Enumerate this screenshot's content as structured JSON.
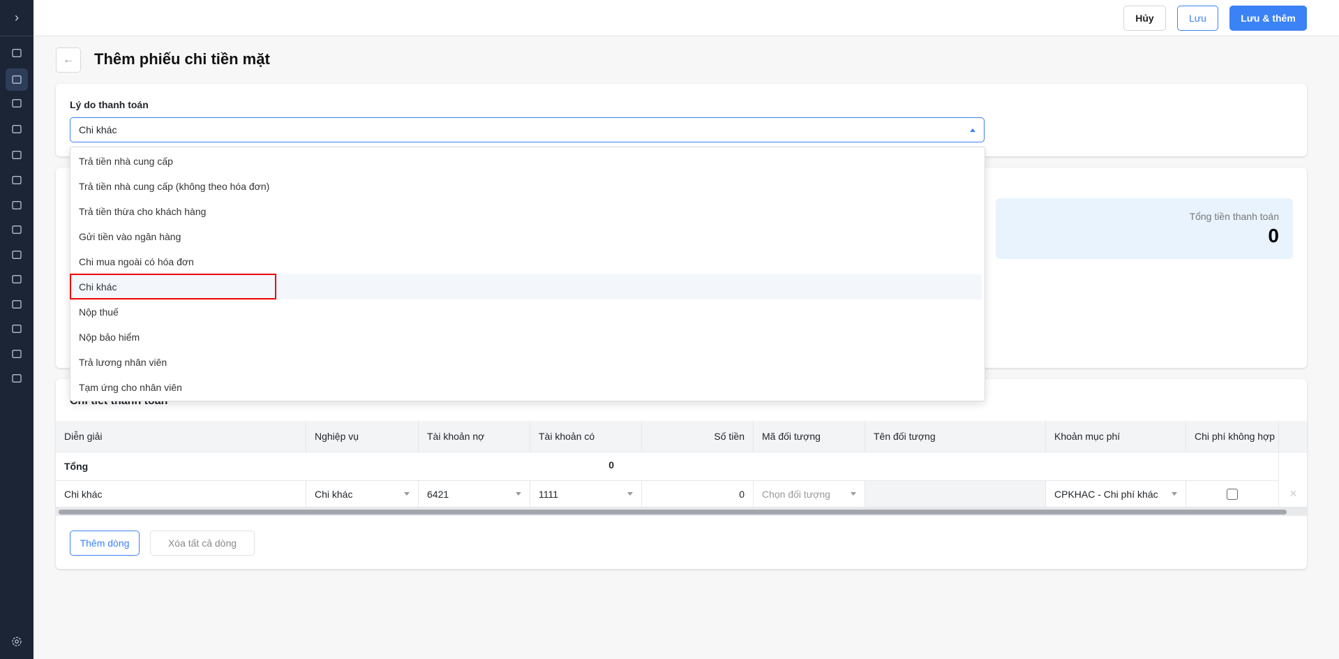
{
  "sidebar": {
    "toggle": "›",
    "items": [
      "home",
      "cash-register",
      "card",
      "bag",
      "cart",
      "warehouse",
      "building",
      "tools",
      "hand-coin",
      "bank",
      "invoice",
      "document",
      "list",
      "wallet"
    ],
    "active": "cash-register",
    "settings": "gear"
  },
  "header": {
    "cancel": "Hủy",
    "save": "Lưu",
    "save_add": "Lưu & thêm"
  },
  "page": {
    "back": "←",
    "title": "Thêm phiếu chi tiền mặt"
  },
  "reason": {
    "label": "Lý do thanh toán",
    "value": "Chi khác",
    "options": [
      "Trả tiền nhà cung cấp",
      "Trả tiền nhà cung cấp (không theo hóa đơn)",
      "Trả tiền thừa cho khách hàng",
      "Gửi tiền vào ngân hàng",
      "Chi mua ngoài có hóa đơn",
      "Chi khác",
      "Nộp thuế",
      "Nộp bảo hiểm",
      "Trả lương nhân viên",
      "Tạm ứng cho nhân viên"
    ]
  },
  "summary": {
    "label": "Tổng tiền thanh toán",
    "value": "0"
  },
  "details": {
    "title": "Chi tiết thanh toán",
    "columns": [
      "Diễn giải",
      "Nghiệp vụ",
      "Tài khoản nợ",
      "Tài khoản có",
      "Số tiền",
      "Mã đối tượng",
      "Tên đối tượng",
      "Khoản mục phí",
      "Chi phí không hợp"
    ],
    "total": {
      "label": "Tổng",
      "amount": "0"
    },
    "row": {
      "description": "Chi khác",
      "operation": "Chi khác",
      "debit": "6421",
      "credit": "1111",
      "amount": "0",
      "object_code_placeholder": "Chọn đối tượng",
      "object_name": "",
      "expense": "CPKHAC - Chi phí khác",
      "invalid_expense": false,
      "remove": "×"
    },
    "add_row": "Thêm dòng",
    "clear_rows": "Xóa tất cả dòng"
  },
  "colors": {
    "primary": "#3b82f6",
    "sidebar": "#1b2536",
    "highlight_box": "#ee0000"
  }
}
